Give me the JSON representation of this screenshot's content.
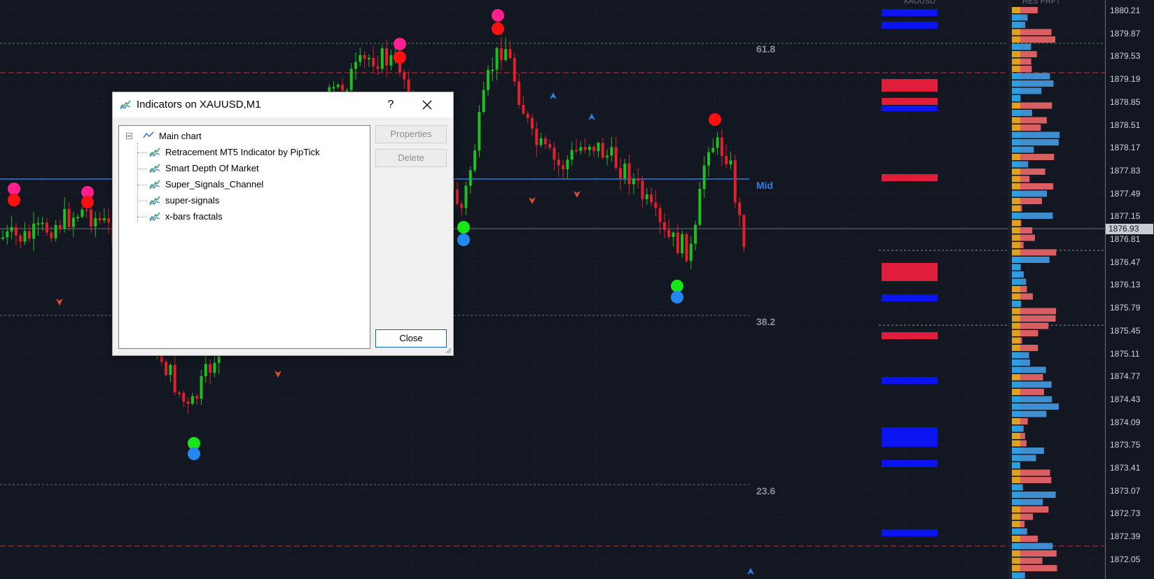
{
  "chart": {
    "symbol_header": "XAUUSD",
    "dom_header": "RES  PRFT",
    "current_price": "1876.93",
    "price_labels": [
      "1880.21",
      "1879.87",
      "1879.53",
      "1879.19",
      "1878.85",
      "1878.51",
      "1878.17",
      "1877.83",
      "1877.49",
      "1877.15",
      "1876.81",
      "1876.47",
      "1876.13",
      "1875.79",
      "1875.45",
      "1875.11",
      "1874.77",
      "1874.43",
      "1874.09",
      "1873.75",
      "1873.41",
      "1873.07",
      "1872.73",
      "1872.39",
      "1872.05"
    ],
    "fib_labels": {
      "fib_618": "61.8",
      "fib_382": "38.2",
      "fib_236": "23.6",
      "mid": "Mid"
    },
    "colors": {
      "background": "#131722",
      "bull": "#1fbf1f",
      "bear": "#e0202a",
      "mid_line": "#2e7fe0",
      "fib_dotted": "#6b6f78",
      "red_dash": "#e02020",
      "dom_blue": "#0a14f0",
      "dom_red": "#e01e3c"
    }
  },
  "dialog": {
    "title": "Indicators on XAUUSD,M1",
    "help_label": "?",
    "root_item": "Main chart",
    "items": [
      "Retracement MT5 Indicator by PipTick",
      "Smart Depth Of Market",
      "Super_Signals_Channel",
      "super-signals",
      "x-bars fractals"
    ],
    "buttons": {
      "properties": "Properties",
      "delete": "Delete",
      "close": "Close"
    },
    "icons": {
      "title": "indicator-icon",
      "close": "close-icon",
      "root": "chart-line-icon",
      "item": "indicator-icon"
    }
  }
}
